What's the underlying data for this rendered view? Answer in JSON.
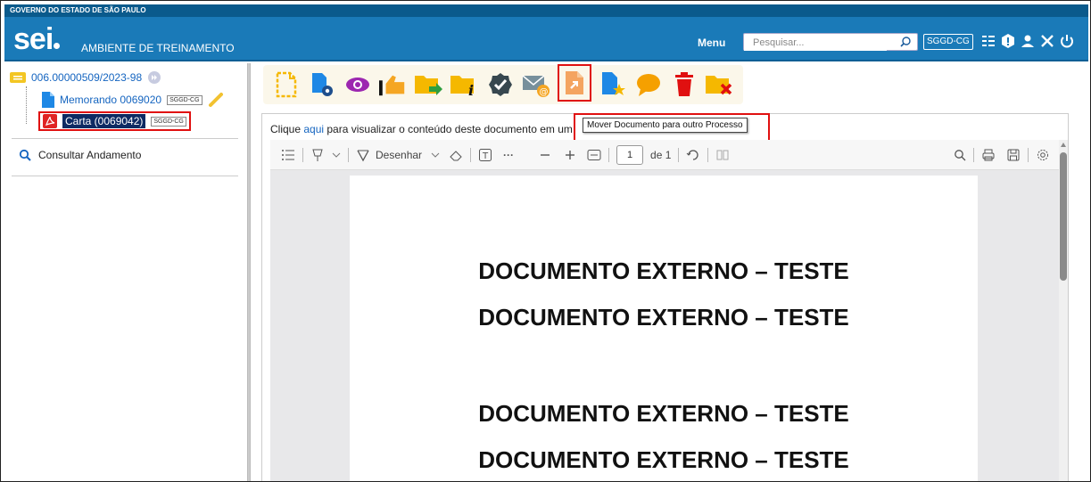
{
  "header": {
    "gov_title": "GOVERNO DO ESTADO DE SÃO PAULO",
    "logo": "sei",
    "environment": "AMBIENTE DE TREINAMENTO",
    "menu_label": "Menu",
    "search_placeholder": "Pesquisar...",
    "unit": "SGGD-CG",
    "icons": [
      "list-icon",
      "alert-icon",
      "user-icon",
      "tools-icon",
      "power-icon"
    ]
  },
  "tree": {
    "process_number": "006.00000509/2023-98",
    "documents": [
      {
        "label": "Memorando 0069020",
        "unit_tag": "SGGD-CG",
        "icon": "document-icon"
      },
      {
        "label": "Carta (0069042)",
        "unit_tag": "SGGD-CG",
        "icon": "pdf-icon"
      }
    ]
  },
  "consult": {
    "label": "Consultar Andamento"
  },
  "toolbar": {
    "buttons": [
      "include-document-icon",
      "process-document-settings-icon",
      "view-icon",
      "sign-icon",
      "send-process-icon",
      "process-info-icon",
      "confirm-icon",
      "send-email-icon",
      "move-document-icon",
      "favorite-document-icon",
      "comment-icon",
      "delete-icon",
      "cancel-document-icon"
    ],
    "tooltip": "Mover Documento para outro Processo"
  },
  "content": {
    "hint_before": "Clique ",
    "hint_link": "aqui",
    "hint_after": " para visualizar o conteúdo deste documento em um"
  },
  "pdf_toolbar": {
    "draw_label": "Desenhar",
    "page_current": "1",
    "page_total": "de 1"
  },
  "pdf": {
    "lines": [
      "DOCUMENTO EXTERNO – TESTE",
      "DOCUMENTO EXTERNO – TESTE",
      "DOCUMENTO EXTERNO – TESTE",
      "DOCUMENTO EXTERNO – TESTE"
    ]
  },
  "colors": {
    "header_blue": "#1a7ab8",
    "gov_bar": "#0a5a8c",
    "highlight_red": "#e01010",
    "selected_doc": "#0d2a63",
    "link_blue": "#1565c0"
  }
}
